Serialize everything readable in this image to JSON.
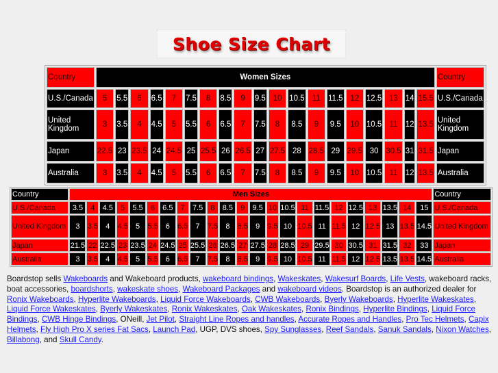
{
  "logo_text": "Shoe Size Chart",
  "colors": {
    "red": "#ff0000",
    "black": "#000000",
    "link": "#1a1aff"
  },
  "women": {
    "country_header": "Country",
    "title": "Women Sizes",
    "rows": [
      {
        "country": "U.S./Canada",
        "sizes": [
          "5",
          "5.5",
          "6",
          "6.5",
          "7",
          "7.5",
          "8",
          "8.5",
          "9",
          "9.5",
          "10",
          "10.5",
          "11",
          "11.5",
          "12",
          "12.5",
          "13",
          "14",
          "15.5"
        ]
      },
      {
        "country": "United Kingdom",
        "sizes": [
          "3",
          "3.5",
          "4",
          "4.5",
          "5",
          "5.5",
          "6",
          "6.5",
          "7",
          "7.5",
          "8",
          "8.5",
          "9",
          "9.5",
          "10",
          "10.5",
          "11",
          "12",
          "13.5"
        ]
      },
      {
        "country": "Japan",
        "sizes": [
          "22.5",
          "23",
          "23.5",
          "24",
          "24.5",
          "25",
          "25.5",
          "26",
          "26.5",
          "27",
          "27.5",
          "28",
          "28.5",
          "29",
          "29.5",
          "30",
          "30.5",
          "31",
          "31.5"
        ]
      },
      {
        "country": "Australia",
        "sizes": [
          "3",
          "3.5",
          "4",
          "4.5",
          "5",
          "5.5",
          "6",
          "6.5",
          "7",
          "7.5",
          "8",
          "8.5",
          "9",
          "9.5",
          "10",
          "10.5",
          "11",
          "12",
          "13.5"
        ]
      }
    ]
  },
  "men": {
    "country_header": "Country",
    "title": "Men Sizes",
    "rows": [
      {
        "country": "U.S./Canada",
        "sizes": [
          "3.5",
          "4",
          "4.5",
          "5",
          "5.5",
          "6",
          "6.5",
          "7",
          "7.5",
          "8",
          "8.5",
          "9",
          "9.5",
          "10",
          "10.5",
          "11",
          "11.5",
          "12",
          "12.5",
          "13",
          "13.5",
          "14",
          "15"
        ]
      },
      {
        "country": "United Kingdom",
        "sizes": [
          "3",
          "3.5",
          "4",
          "4.5",
          "5",
          "5.5",
          "6",
          "6.5",
          "7",
          "7.5",
          "8",
          "8.5",
          "9",
          "9.5",
          "10",
          "10.5",
          "11",
          "11.5",
          "12",
          "12.5",
          "13",
          "13.5",
          "14.5"
        ]
      },
      {
        "country": "Japan",
        "sizes": [
          "21.5",
          "22",
          "22.5",
          "23",
          "23.5",
          "24",
          "24.5",
          "25",
          "25.5",
          "26",
          "26.5",
          "27",
          "27.5",
          "28",
          "28.5",
          "29",
          "29.5",
          "30",
          "30.5",
          "31",
          "31.5",
          "32",
          "33"
        ]
      },
      {
        "country": "Australia",
        "sizes": [
          "3",
          "3.5",
          "4",
          "4.5",
          "5",
          "5.5",
          "6",
          "6.5",
          "7",
          "7.5",
          "8",
          "8.5",
          "9",
          "9.5",
          "10",
          "10.5",
          "11",
          "11.5",
          "12",
          "12.5",
          "13.5",
          "13.5",
          "14.5"
        ]
      }
    ]
  },
  "description": [
    {
      "t": "Boardstop sells "
    },
    {
      "t": "Wakeboards",
      "link": true
    },
    {
      "t": " and Wakeboard products, "
    },
    {
      "t": "wakeboard bindings",
      "link": true
    },
    {
      "t": ", "
    },
    {
      "t": "Wakeskates",
      "link": true
    },
    {
      "t": ", "
    },
    {
      "t": "Wakesurf Boards",
      "link": true
    },
    {
      "t": ", "
    },
    {
      "t": "Life Vests",
      "link": true
    },
    {
      "t": ", wakeboard racks, boat accessories, "
    },
    {
      "t": "boardshorts",
      "link": true
    },
    {
      "t": ", "
    },
    {
      "t": "wakeskate shoes",
      "link": true
    },
    {
      "t": ", "
    },
    {
      "t": "Wakeboard Packages",
      "link": true
    },
    {
      "t": " and "
    },
    {
      "t": "wakeboard videos",
      "link": true
    },
    {
      "t": ". Boardstop is an authorized dealer for "
    },
    {
      "t": "Ronix Wakeboards",
      "link": true
    },
    {
      "t": ", "
    },
    {
      "t": "Hyperlite Wakeboards",
      "link": true
    },
    {
      "t": ", "
    },
    {
      "t": "Liquid Force Wakeboards",
      "link": true
    },
    {
      "t": ", "
    },
    {
      "t": "CWB Wakeboards",
      "link": true
    },
    {
      "t": ", "
    },
    {
      "t": "Byerly Wakeboards",
      "link": true
    },
    {
      "t": ", "
    },
    {
      "t": "Hyperlite Wakeskates",
      "link": true
    },
    {
      "t": ", "
    },
    {
      "t": "Liquid Force Wakeskates",
      "link": true
    },
    {
      "t": ", "
    },
    {
      "t": "Byerly Wakeskates",
      "link": true
    },
    {
      "t": ", "
    },
    {
      "t": "Ronix Wakeskates",
      "link": true
    },
    {
      "t": ", "
    },
    {
      "t": "Oak Wakeskates",
      "link": true
    },
    {
      "t": ", "
    },
    {
      "t": "Ronix Bindings",
      "link": true
    },
    {
      "t": ", "
    },
    {
      "t": "Hyperlite Bindings",
      "link": true
    },
    {
      "t": ", "
    },
    {
      "t": "Liquid Force Bindings",
      "link": true
    },
    {
      "t": ", "
    },
    {
      "t": "CWB Hinge Bindings",
      "link": true
    },
    {
      "t": ", ONeill, "
    },
    {
      "t": "Jet Pilot",
      "link": true
    },
    {
      "t": ", "
    },
    {
      "t": "Straight Line Ropes and handles",
      "link": true
    },
    {
      "t": ", "
    },
    {
      "t": "Accurate Ropes and Handles",
      "link": true
    },
    {
      "t": ", "
    },
    {
      "t": "Pro Tec Helmets",
      "link": true
    },
    {
      "t": ", "
    },
    {
      "t": "Capix Helmets",
      "link": true
    },
    {
      "t": ", "
    },
    {
      "t": "Fly High Pro X series Fat Sacs",
      "link": true
    },
    {
      "t": ", "
    },
    {
      "t": "Launch Pad",
      "link": true
    },
    {
      "t": ", UGP, DVS shoes, "
    },
    {
      "t": "Spy Sunglasses",
      "link": true
    },
    {
      "t": ", "
    },
    {
      "t": "Reef Sandals",
      "link": true
    },
    {
      "t": ", "
    },
    {
      "t": "Sanuk Sandals",
      "link": true
    },
    {
      "t": ", "
    },
    {
      "t": "Nixon Watches",
      "link": true
    },
    {
      "t": ", "
    },
    {
      "t": "Billabong",
      "link": true
    },
    {
      "t": ", and "
    },
    {
      "t": "Skull Candy",
      "link": true
    },
    {
      "t": "."
    }
  ]
}
